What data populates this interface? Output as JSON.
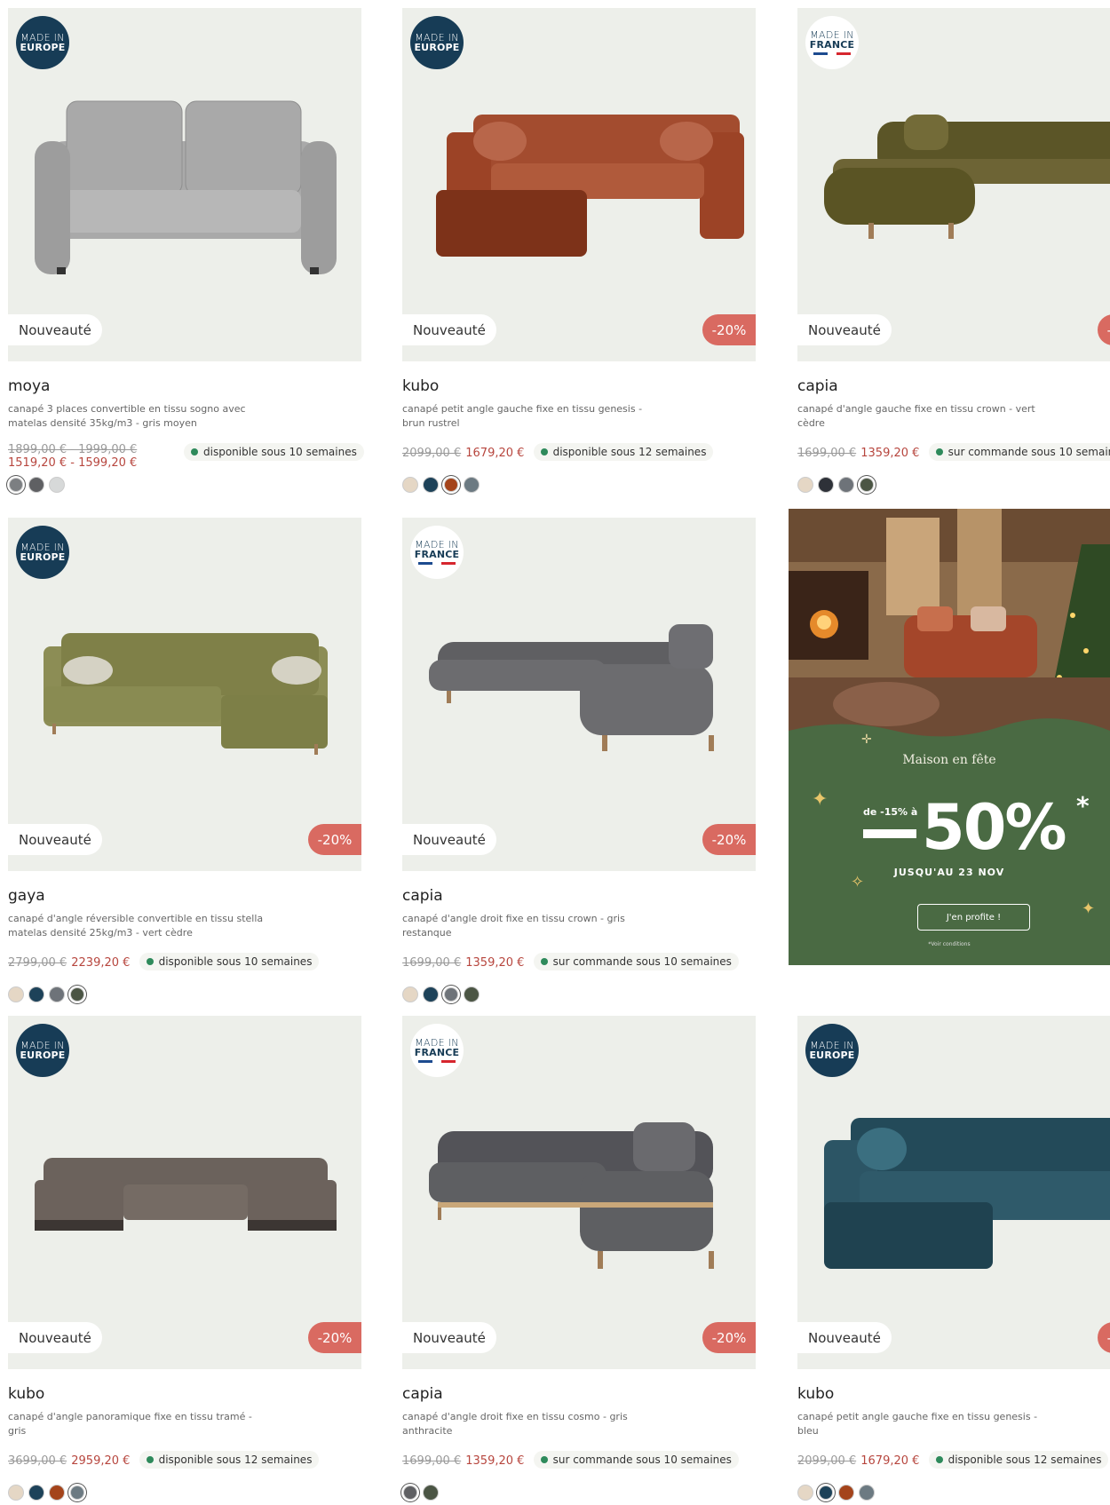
{
  "labels": {
    "made_in": "MADE IN",
    "europe": "EUROPE",
    "france": "FRANCE",
    "new": "Nouveauté",
    "promo": "-20%"
  },
  "products": [
    {
      "name": "moya",
      "desc_1": "canapé 3 places convertible en tissu sogno avec",
      "desc_2": "matelas densité 35kg/m3 - gris moyen",
      "old_price": "1899,00 € - 1999,00 €",
      "new_price": "1519,20 € - 1599,20 €",
      "availability": "disponible sous 10 semaines",
      "badge": "europe",
      "promo": false,
      "swatches": [
        "#7c7f82",
        "#5f6063",
        "#d7d9d9"
      ],
      "selected": 0
    },
    {
      "name": "kubo",
      "desc_1": "canapé petit angle gauche fixe en tissu genesis -",
      "desc_2": "brun rustrel",
      "old_price": "2099,00 €",
      "new_price": "1679,20 €",
      "availability": "disponible sous 12 semaines",
      "badge": "europe",
      "promo": true,
      "swatches": [
        "#e5d7c5",
        "#1d4259",
        "#a4441b",
        "#6c7a82"
      ],
      "selected": 2
    },
    {
      "name": "capia",
      "desc_1": "canapé d'angle gauche fixe en tissu crown - vert",
      "desc_2": "cèdre",
      "old_price": "1699,00 €",
      "new_price": "1359,20 €",
      "availability": "sur commande sous 10 semaines",
      "badge": "france",
      "promo": true,
      "swatches": [
        "#e5d7c5",
        "#2e3138",
        "#6e7379",
        "#4b5544"
      ],
      "selected": 3
    },
    {
      "name": "gaya",
      "desc_1": "canapé d'angle réversible convertible en tissu stella",
      "desc_2": "matelas densité 25kg/m3 - vert cèdre",
      "old_price": "2799,00 €",
      "new_price": "2239,20 €",
      "availability": "disponible sous 10 semaines",
      "badge": "europe",
      "promo": true,
      "swatches": [
        "#e5d7c5",
        "#1d4259",
        "#6e7379",
        "#4b5544"
      ],
      "selected": 3
    },
    {
      "name": "capia",
      "desc_1": "canapé d'angle droit fixe en tissu crown - gris",
      "desc_2": "restanque",
      "old_price": "1699,00 €",
      "new_price": "1359,20 €",
      "availability": "sur commande sous 10 semaines",
      "badge": "france",
      "promo": true,
      "swatches": [
        "#e5d7c5",
        "#1d4259",
        "#6e7379",
        "#4b5544"
      ],
      "selected": 2
    },
    {
      "name": "kubo",
      "desc_1": "canapé d'angle panoramique fixe en tissu tramé -",
      "desc_2": "gris",
      "old_price": "3699,00 €",
      "new_price": "2959,20 €",
      "availability": "disponible sous 12 semaines",
      "badge": "europe",
      "promo": true,
      "swatches": [
        "#e5d7c5",
        "#1d4259",
        "#a4441b",
        "#6c7a82"
      ],
      "selected": 3
    },
    {
      "name": "capia",
      "desc_1": "canapé d'angle droit fixe en tissu cosmo - gris",
      "desc_2": "anthracite",
      "old_price": "1699,00 €",
      "new_price": "1359,20 €",
      "availability": "sur commande sous 10 semaines",
      "badge": "france",
      "promo": true,
      "swatches": [
        "#5f6063",
        "#4b5544"
      ],
      "selected": 0
    },
    {
      "name": "kubo",
      "desc_1": "canapé petit angle gauche fixe en tissu genesis -",
      "desc_2": "bleu",
      "old_price": "2099,00 €",
      "new_price": "1679,20 €",
      "availability": "disponible sous 12 semaines",
      "badge": "europe",
      "promo": true,
      "swatches": [
        "#e5d7c5",
        "#1d4259",
        "#a4441b",
        "#6c7a82"
      ],
      "selected": 1
    }
  ],
  "sofa_colors": [
    "#a9a9a9",
    "#b05a3b",
    "#6d6435",
    "#8c8d55",
    "#6c6c6f",
    "#6c625c",
    "#5e5f62",
    "#2f5a6a"
  ],
  "promo_banner": {
    "title": "Maison en fête",
    "from": "de -15% à",
    "big": "50%",
    "star": "*",
    "until": "JUSQU'AU 23 NOV",
    "cta": "J'en profite !",
    "conditions": "*Voir conditions",
    "bg_color": "#4a6a43"
  }
}
